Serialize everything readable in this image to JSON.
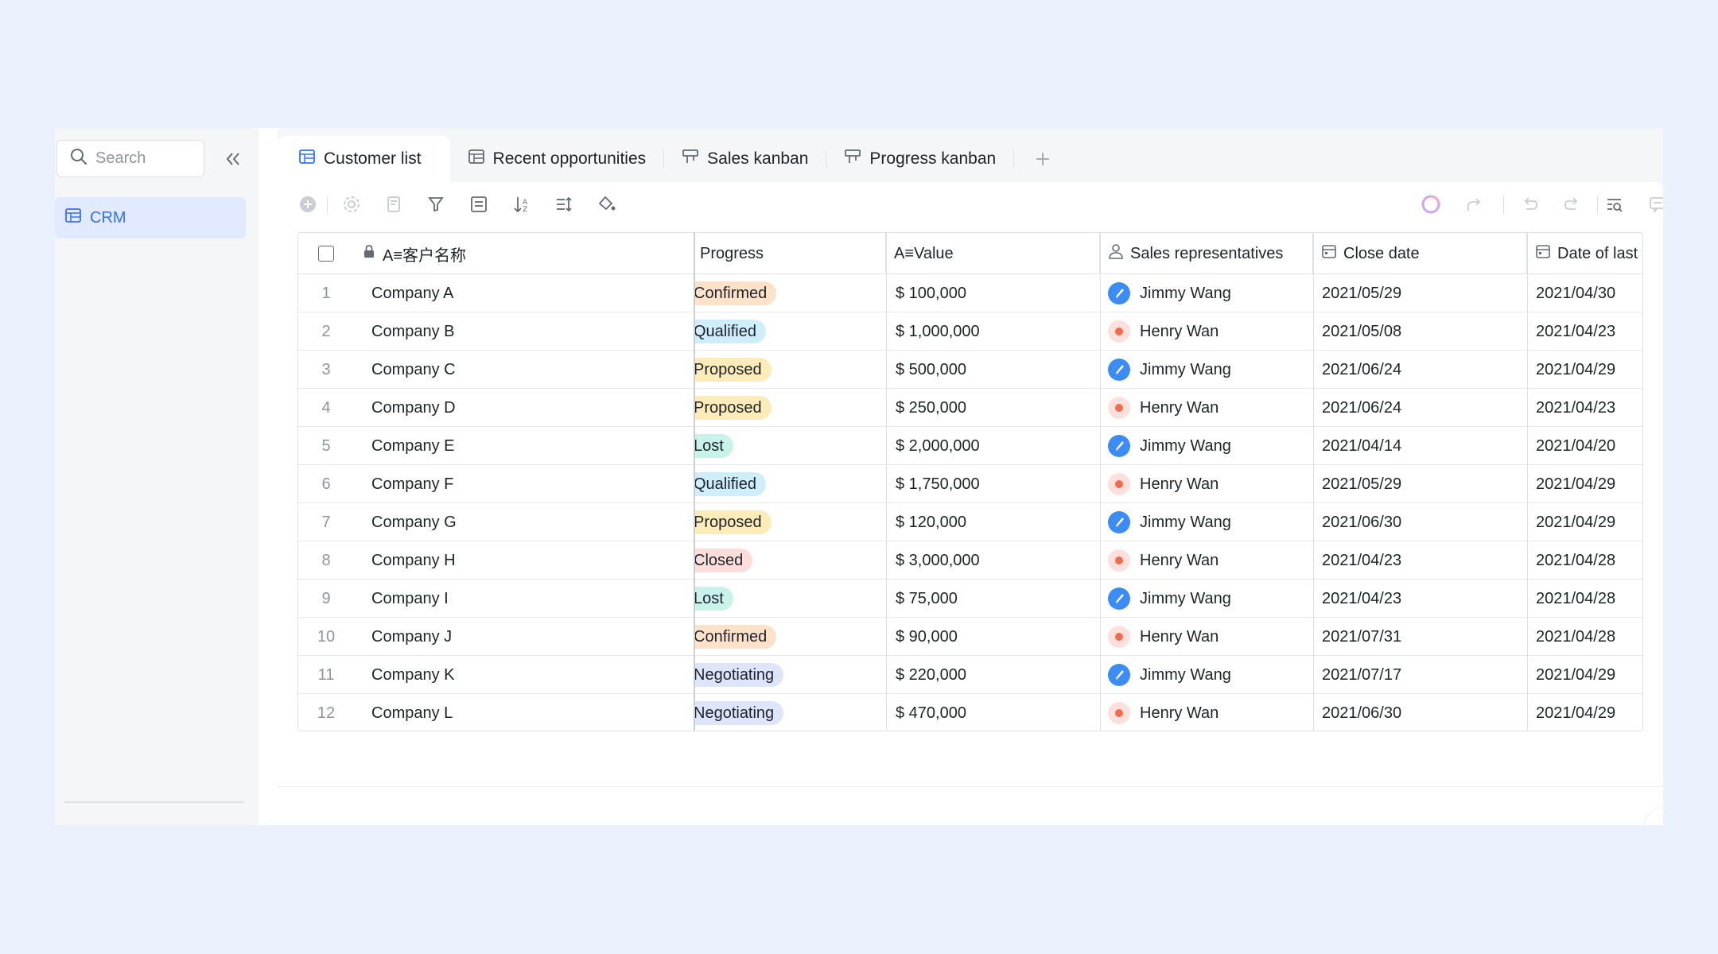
{
  "sidebar": {
    "search_placeholder": "Search",
    "items": [
      {
        "label": "CRM",
        "icon": "table-icon"
      }
    ]
  },
  "tabs": [
    {
      "label": "Customer list",
      "icon": "grid-table-icon",
      "active": true
    },
    {
      "label": "Recent opportunities",
      "icon": "grid-table-icon",
      "active": false
    },
    {
      "label": "Sales kanban",
      "icon": "kanban-icon",
      "active": false
    },
    {
      "label": "Progress kanban",
      "icon": "kanban-icon",
      "active": false
    }
  ],
  "columns": {
    "name": "A≡客户名称",
    "progress": "Progress",
    "value": "A≡Value",
    "sales_rep": "Sales representatives",
    "close_date": "Close date",
    "last_date": "Date of last"
  },
  "rows": [
    {
      "num": "1",
      "name": "Company A",
      "progress": "Confirmed",
      "value": "$ 100,000",
      "rep": "Jimmy Wang",
      "close": "2021/05/29",
      "last": "2021/04/30"
    },
    {
      "num": "2",
      "name": "Company B",
      "progress": "Qualified",
      "value": "$ 1,000,000",
      "rep": "Henry Wan",
      "close": "2021/05/08",
      "last": "2021/04/23"
    },
    {
      "num": "3",
      "name": "Company C",
      "progress": "Proposed",
      "value": "$ 500,000",
      "rep": "Jimmy Wang",
      "close": "2021/06/24",
      "last": "2021/04/29"
    },
    {
      "num": "4",
      "name": "Company D",
      "progress": "Proposed",
      "value": "$ 250,000",
      "rep": "Henry Wan",
      "close": "2021/06/24",
      "last": "2021/04/23"
    },
    {
      "num": "5",
      "name": "Company E",
      "progress": "Lost",
      "value": "$ 2,000,000",
      "rep": "Jimmy Wang",
      "close": "2021/04/14",
      "last": "2021/04/20"
    },
    {
      "num": "6",
      "name": "Company F",
      "progress": "Qualified",
      "value": "$ 1,750,000",
      "rep": "Henry Wan",
      "close": "2021/05/29",
      "last": "2021/04/29"
    },
    {
      "num": "7",
      "name": "Company G",
      "progress": "Proposed",
      "value": "$ 120,000",
      "rep": "Jimmy Wang",
      "close": "2021/06/30",
      "last": "2021/04/29"
    },
    {
      "num": "8",
      "name": "Company H",
      "progress": "Closed",
      "value": "$ 3,000,000",
      "rep": "Henry Wan",
      "close": "2021/04/23",
      "last": "2021/04/28"
    },
    {
      "num": "9",
      "name": "Company I",
      "progress": "Lost",
      "value": "$ 75,000",
      "rep": "Jimmy Wang",
      "close": "2021/04/23",
      "last": "2021/04/28"
    },
    {
      "num": "10",
      "name": "Company J",
      "progress": "Confirmed",
      "value": "$ 90,000",
      "rep": "Henry Wan",
      "close": "2021/07/31",
      "last": "2021/04/28"
    },
    {
      "num": "11",
      "name": "Company K",
      "progress": "Negotiating",
      "value": "$ 220,000",
      "rep": "Jimmy Wang",
      "close": "2021/07/17",
      "last": "2021/04/29"
    },
    {
      "num": "12",
      "name": "Company L",
      "progress": "Negotiating",
      "value": "$ 470,000",
      "rep": "Henry Wan",
      "close": "2021/06/30",
      "last": "2021/04/29"
    }
  ],
  "progress_colors": {
    "Confirmed": "#fde2c9",
    "Qualified": "#cdeefa",
    "Proposed": "#fdecb8",
    "Lost": "#c9f2ea",
    "Closed": "#fddcdc",
    "Negotiating": "#dde5fb"
  },
  "rep_colors": {
    "Jimmy Wang": "#3b8cf5",
    "Henry Wan": "#fde0dc"
  },
  "accent": "#3370ff"
}
